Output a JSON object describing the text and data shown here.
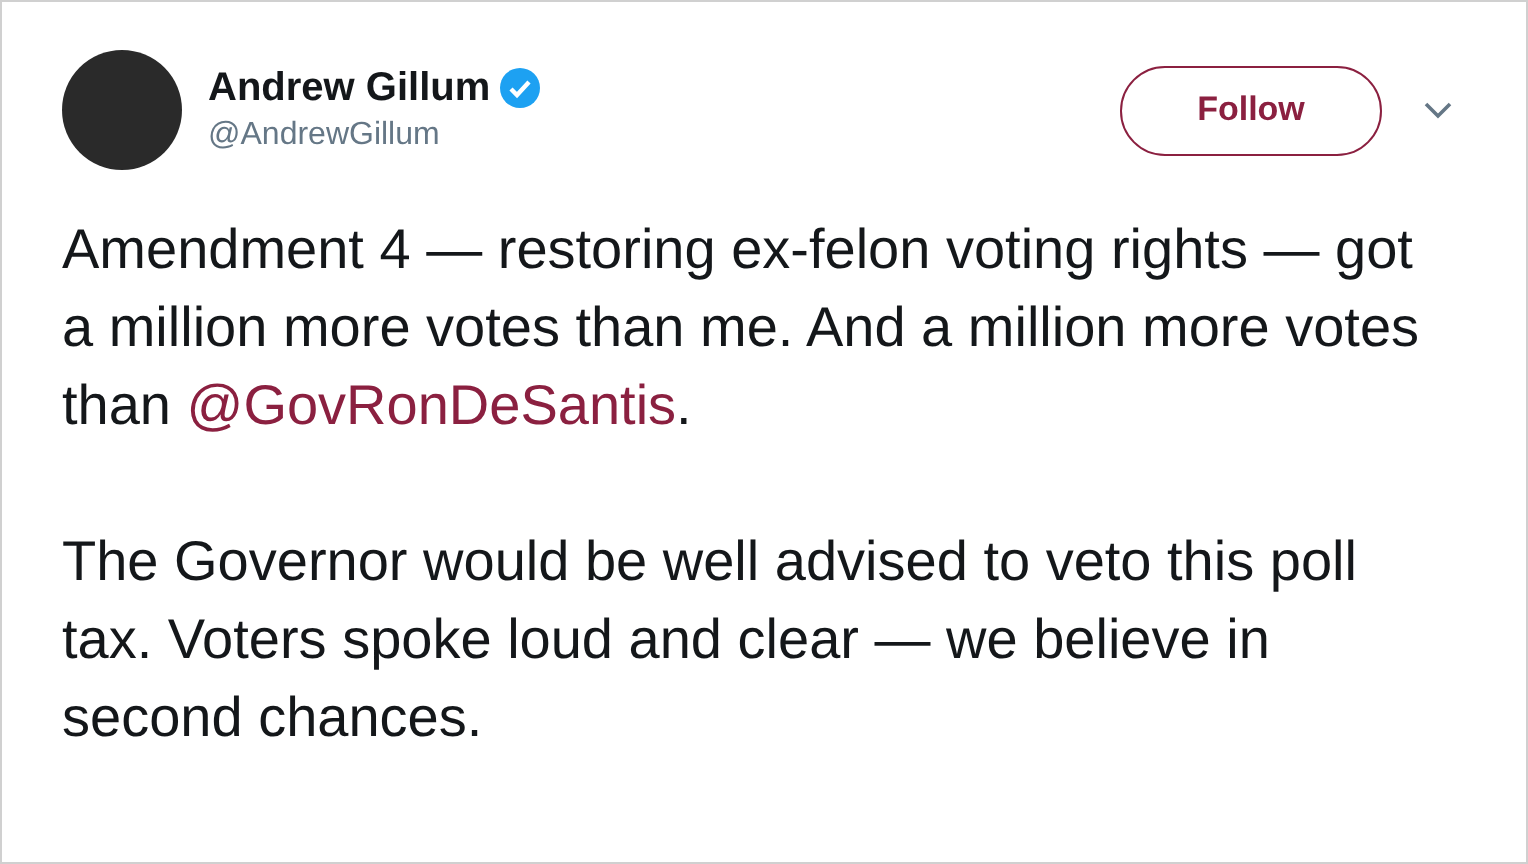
{
  "tweet": {
    "author": {
      "name": "Andrew Gillum",
      "verified": true,
      "handle": "@AndrewGillum"
    },
    "follow_button": "Follow",
    "paragraphs": [
      {
        "text": "Amendment 4 — restoring ex-felon voting rights — got a million more votes than me. And a million more votes than ",
        "mention": "@GovRonDeSantis",
        "after": "."
      },
      {
        "text": "The Governor would be well advised to veto this poll tax. Voters spoke loud and clear — we believe in second chances."
      }
    ]
  }
}
